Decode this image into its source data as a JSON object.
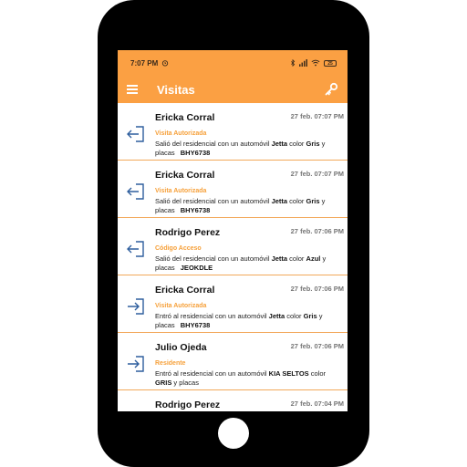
{
  "status_bar": {
    "time": "7:07 PM",
    "battery": "25"
  },
  "app_bar": {
    "title": "Visitas"
  },
  "colors": {
    "accent": "#fba043",
    "type_label": "#f6a03a",
    "icon_blue": "#2f5f9e"
  },
  "visits": [
    {
      "name": "Ericka Corral",
      "date": "27 feb. 07:07 PM",
      "type": "Visita Autorizada",
      "direction": "exit",
      "desc_prefix": "Salió del residencial con un automóvil ",
      "car": "Jetta",
      "mid": " color ",
      "color": "Gris",
      "plates_label": " y placas ",
      "plates": "BHY6738"
    },
    {
      "name": "Ericka Corral",
      "date": "27 feb. 07:07 PM",
      "type": "Visita Autorizada",
      "direction": "exit",
      "desc_prefix": "Salió del residencial con un automóvil ",
      "car": "Jetta",
      "mid": " color ",
      "color": "Gris",
      "plates_label": " y placas ",
      "plates": "BHY6738"
    },
    {
      "name": "Rodrigo Perez",
      "date": "27 feb. 07:06 PM",
      "type": "Código Acceso",
      "direction": "exit",
      "desc_prefix": "Salió del residencial con un automóvil ",
      "car": "Jetta",
      "mid": " color ",
      "color": "Azul",
      "plates_label": " y placas ",
      "plates": "JEOKDLE"
    },
    {
      "name": "Ericka Corral",
      "date": "27 feb. 07:06 PM",
      "type": "Visita Autorizada",
      "direction": "enter",
      "desc_prefix": "Entró al residencial con un automóvil ",
      "car": "Jetta",
      "mid": " color ",
      "color": "Gris",
      "plates_label": " y placas ",
      "plates": "BHY6738"
    },
    {
      "name": "Julio Ojeda",
      "date": "27 feb. 07:06 PM",
      "type": "Residente",
      "direction": "enter",
      "desc_prefix": "Entró al residencial con un automóvil ",
      "car": "KIA SELTOS",
      "mid": " color ",
      "color": "GRIS",
      "plates_label": " y placas",
      "plates": ""
    },
    {
      "name": "Rodrigo Perez",
      "date": "27 feb. 07:04 PM",
      "type": "",
      "direction": "enter",
      "desc_prefix": "",
      "car": "",
      "mid": "",
      "color": "",
      "plates_label": "",
      "plates": ""
    }
  ]
}
